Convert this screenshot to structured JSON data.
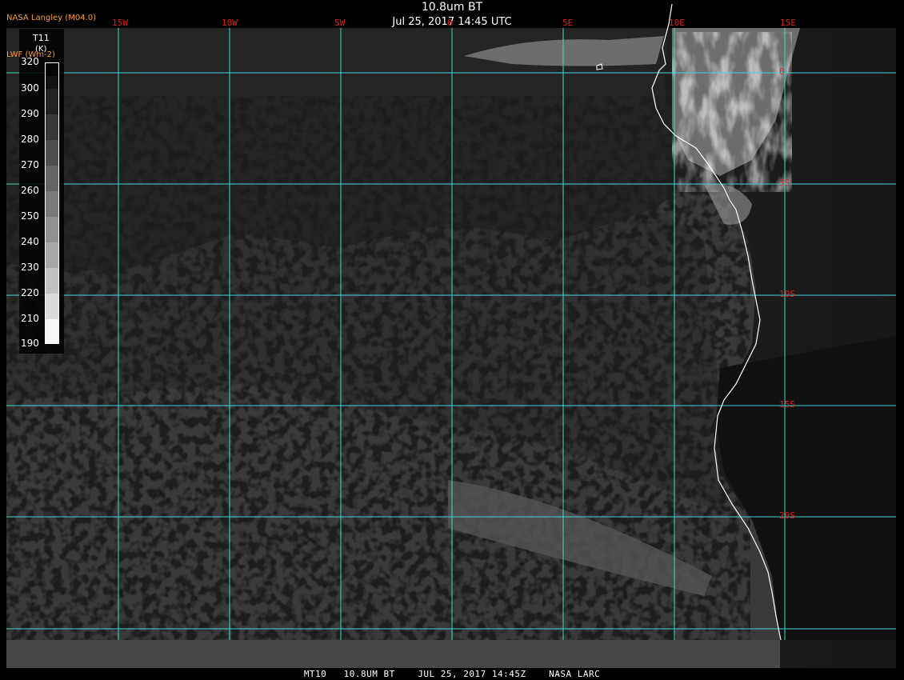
{
  "header": {
    "title": "10.8um BT",
    "datetime": "Jul 25, 2017 14:45 UTC",
    "credit": "NASA Langley (M04.0)"
  },
  "legend": {
    "variable": "T11",
    "unit": "(K)",
    "secondary": "LWF (Wm-2)",
    "ticks": [
      "320",
      "300",
      "290",
      "280",
      "270",
      "260",
      "250",
      "240",
      "230",
      "220",
      "210",
      "190"
    ]
  },
  "graticule": {
    "longitude_labels": [
      "15W",
      "10W",
      "5W",
      "0",
      "5E",
      "10E",
      "15E"
    ],
    "latitude_labels": [
      "0",
      "5S",
      "10S",
      "15S",
      "20S"
    ]
  },
  "footer": {
    "caption": "MT10   10.8UM BT    JUL 25, 2017 14:45Z    NASA LARC"
  },
  "colors": {
    "grid": "#40d8d8",
    "coastline": "#ffffff",
    "label_red": "#e0201a",
    "credit_orange": "#ff9a2e"
  }
}
